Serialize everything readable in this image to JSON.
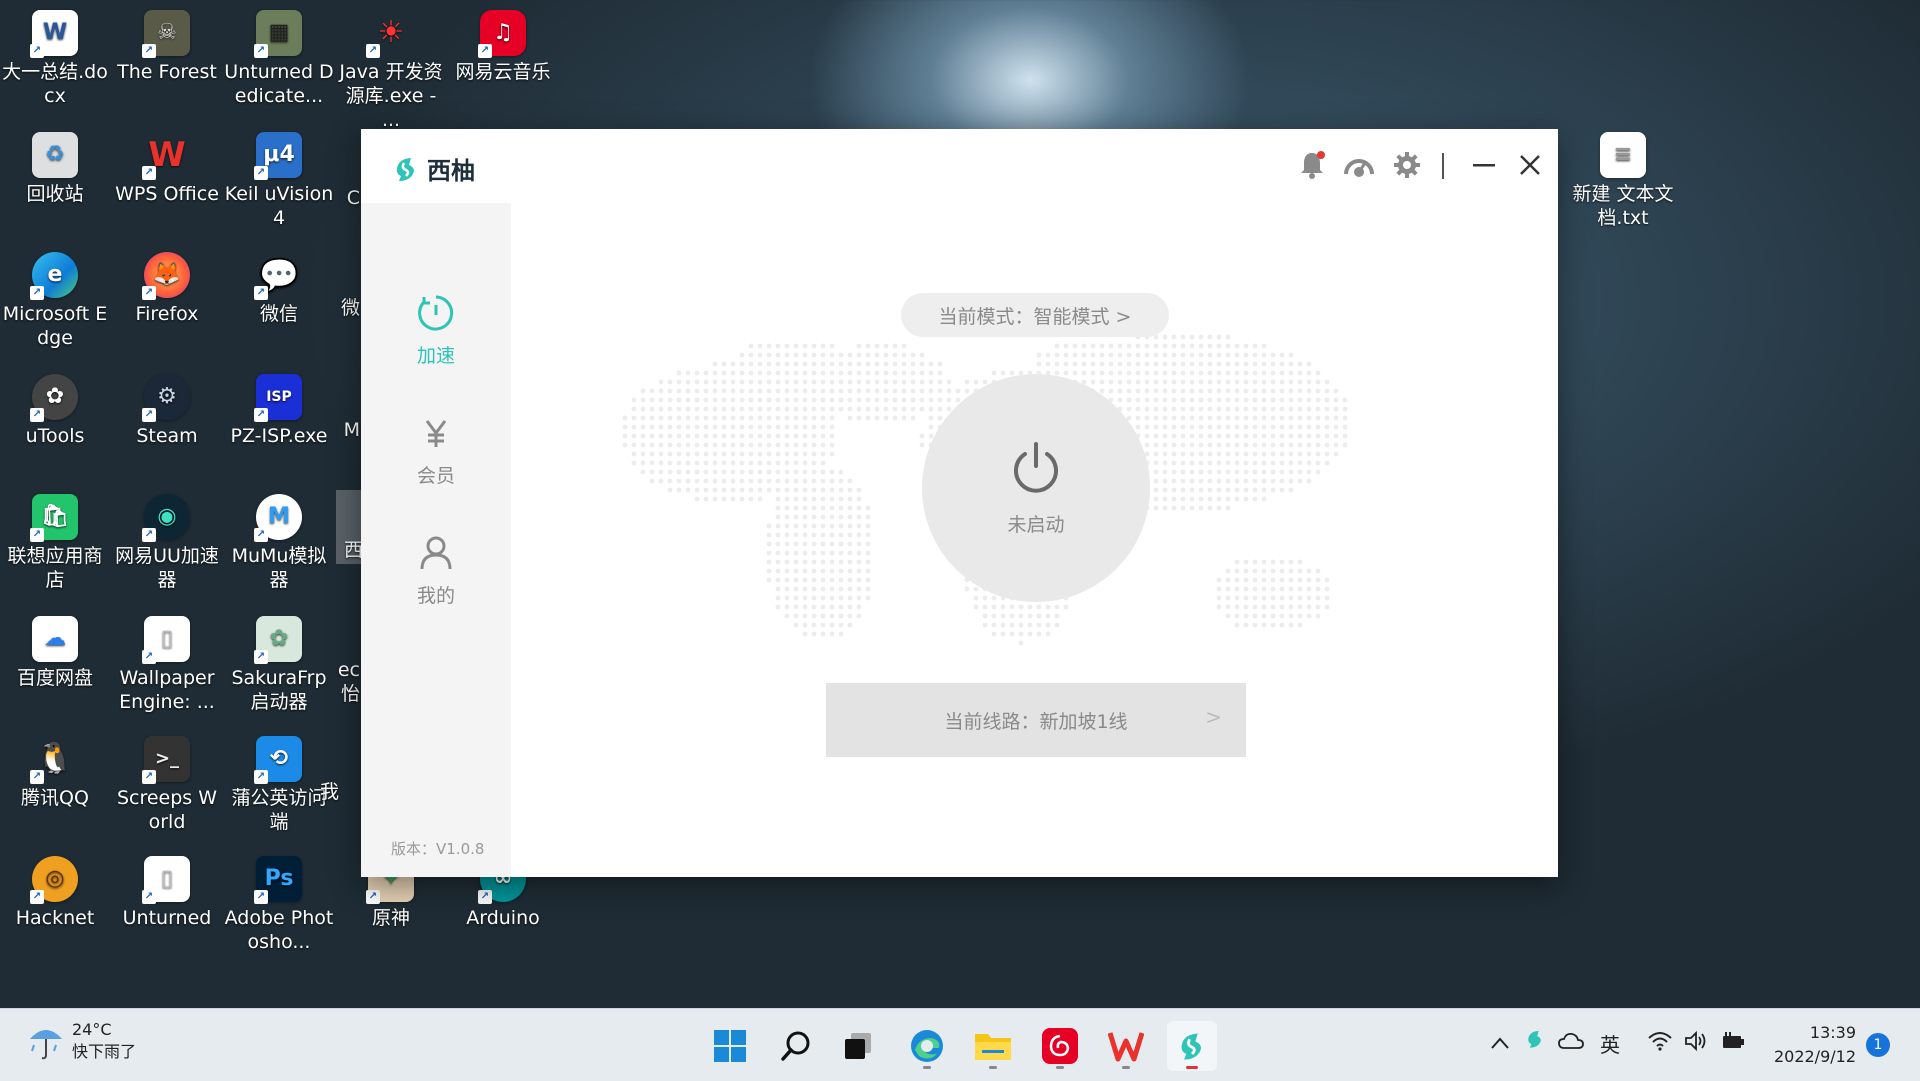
{
  "desktop": {
    "icons": [
      {
        "label": "大一总结.docx",
        "icon": "word-doc-icon"
      },
      {
        "label": "The Forest",
        "icon": "the-forest-icon"
      },
      {
        "label": "Unturned Dedicate...",
        "icon": "unturned-server-icon"
      },
      {
        "label": "Java 开发资源库.exe - ...",
        "icon": "java-icon"
      },
      {
        "label": "网易云音乐",
        "icon": "netease-music-icon"
      },
      {
        "label": "回收站",
        "icon": "recycle-bin-icon"
      },
      {
        "label": "WPS Office",
        "icon": "wps-office-icon"
      },
      {
        "label": "Keil uVision4",
        "icon": "keil-icon"
      },
      {
        "label": "Microsoft Edge",
        "icon": "edge-icon"
      },
      {
        "label": "Firefox",
        "icon": "firefox-icon"
      },
      {
        "label": "微信",
        "icon": "wechat-icon"
      },
      {
        "label": "uTools",
        "icon": "utools-icon"
      },
      {
        "label": "Steam",
        "icon": "steam-icon"
      },
      {
        "label": "PZ-ISP.exe",
        "icon": "pz-isp-icon"
      },
      {
        "label": "联想应用商店",
        "icon": "lenovo-store-icon"
      },
      {
        "label": "网易UU加速器",
        "icon": "uu-booster-icon"
      },
      {
        "label": "MuMu模拟器",
        "icon": "mumu-icon"
      },
      {
        "label": "百度网盘",
        "icon": "baidu-netdisk-icon"
      },
      {
        "label": "Wallpaper Engine: ...",
        "icon": "file-icon"
      },
      {
        "label": "SakuraFrp 启动器",
        "icon": "sakurafrp-icon"
      },
      {
        "label": "腾讯QQ",
        "icon": "qq-icon"
      },
      {
        "label": "Screeps World",
        "icon": "screeps-icon"
      },
      {
        "label": "蒲公英访问端",
        "icon": "pgy-icon"
      },
      {
        "label": "Hacknet",
        "icon": "hacknet-icon"
      },
      {
        "label": "Unturned",
        "icon": "file-icon"
      },
      {
        "label": "Adobe Photosho...",
        "icon": "photoshop-icon"
      },
      {
        "label": "原神",
        "icon": "genshin-icon"
      },
      {
        "label": "Arduino",
        "icon": "arduino-icon"
      },
      {
        "label": "新建 文本文档.txt",
        "icon": "text-file-icon"
      }
    ],
    "partial_labels": [
      "C",
      "微",
      "M",
      "西",
      "ec",
      "怡",
      "我"
    ]
  },
  "app": {
    "name": "西柚",
    "brand_color": "#2fc4b8",
    "titlebar_icons": [
      "bell-icon",
      "speedometer-icon",
      "gear-icon",
      "minimize-icon",
      "close-icon"
    ],
    "nav": [
      {
        "label": "加速",
        "icon": "clock-icon",
        "active": true
      },
      {
        "label": "会员",
        "icon": "yen-icon",
        "active": false
      },
      {
        "label": "我的",
        "icon": "user-icon",
        "active": false
      }
    ],
    "version": "版本：V1.0.8",
    "mode_label": "当前模式：智能模式 >",
    "status": "未启动",
    "route_label": "当前线路：新加坡1线",
    "route_arrow": ">"
  },
  "taskbar": {
    "weather_temp": "24°C",
    "weather_desc": "快下雨了",
    "apps": [
      "windows-start-icon",
      "search-icon",
      "task-view-icon",
      "edge-icon",
      "file-explorer-icon",
      "netease-music-icon",
      "wps-icon",
      "xiyou-icon"
    ],
    "ime": "英",
    "time": "13:39",
    "date": "2022/9/12",
    "notifications": "1"
  }
}
